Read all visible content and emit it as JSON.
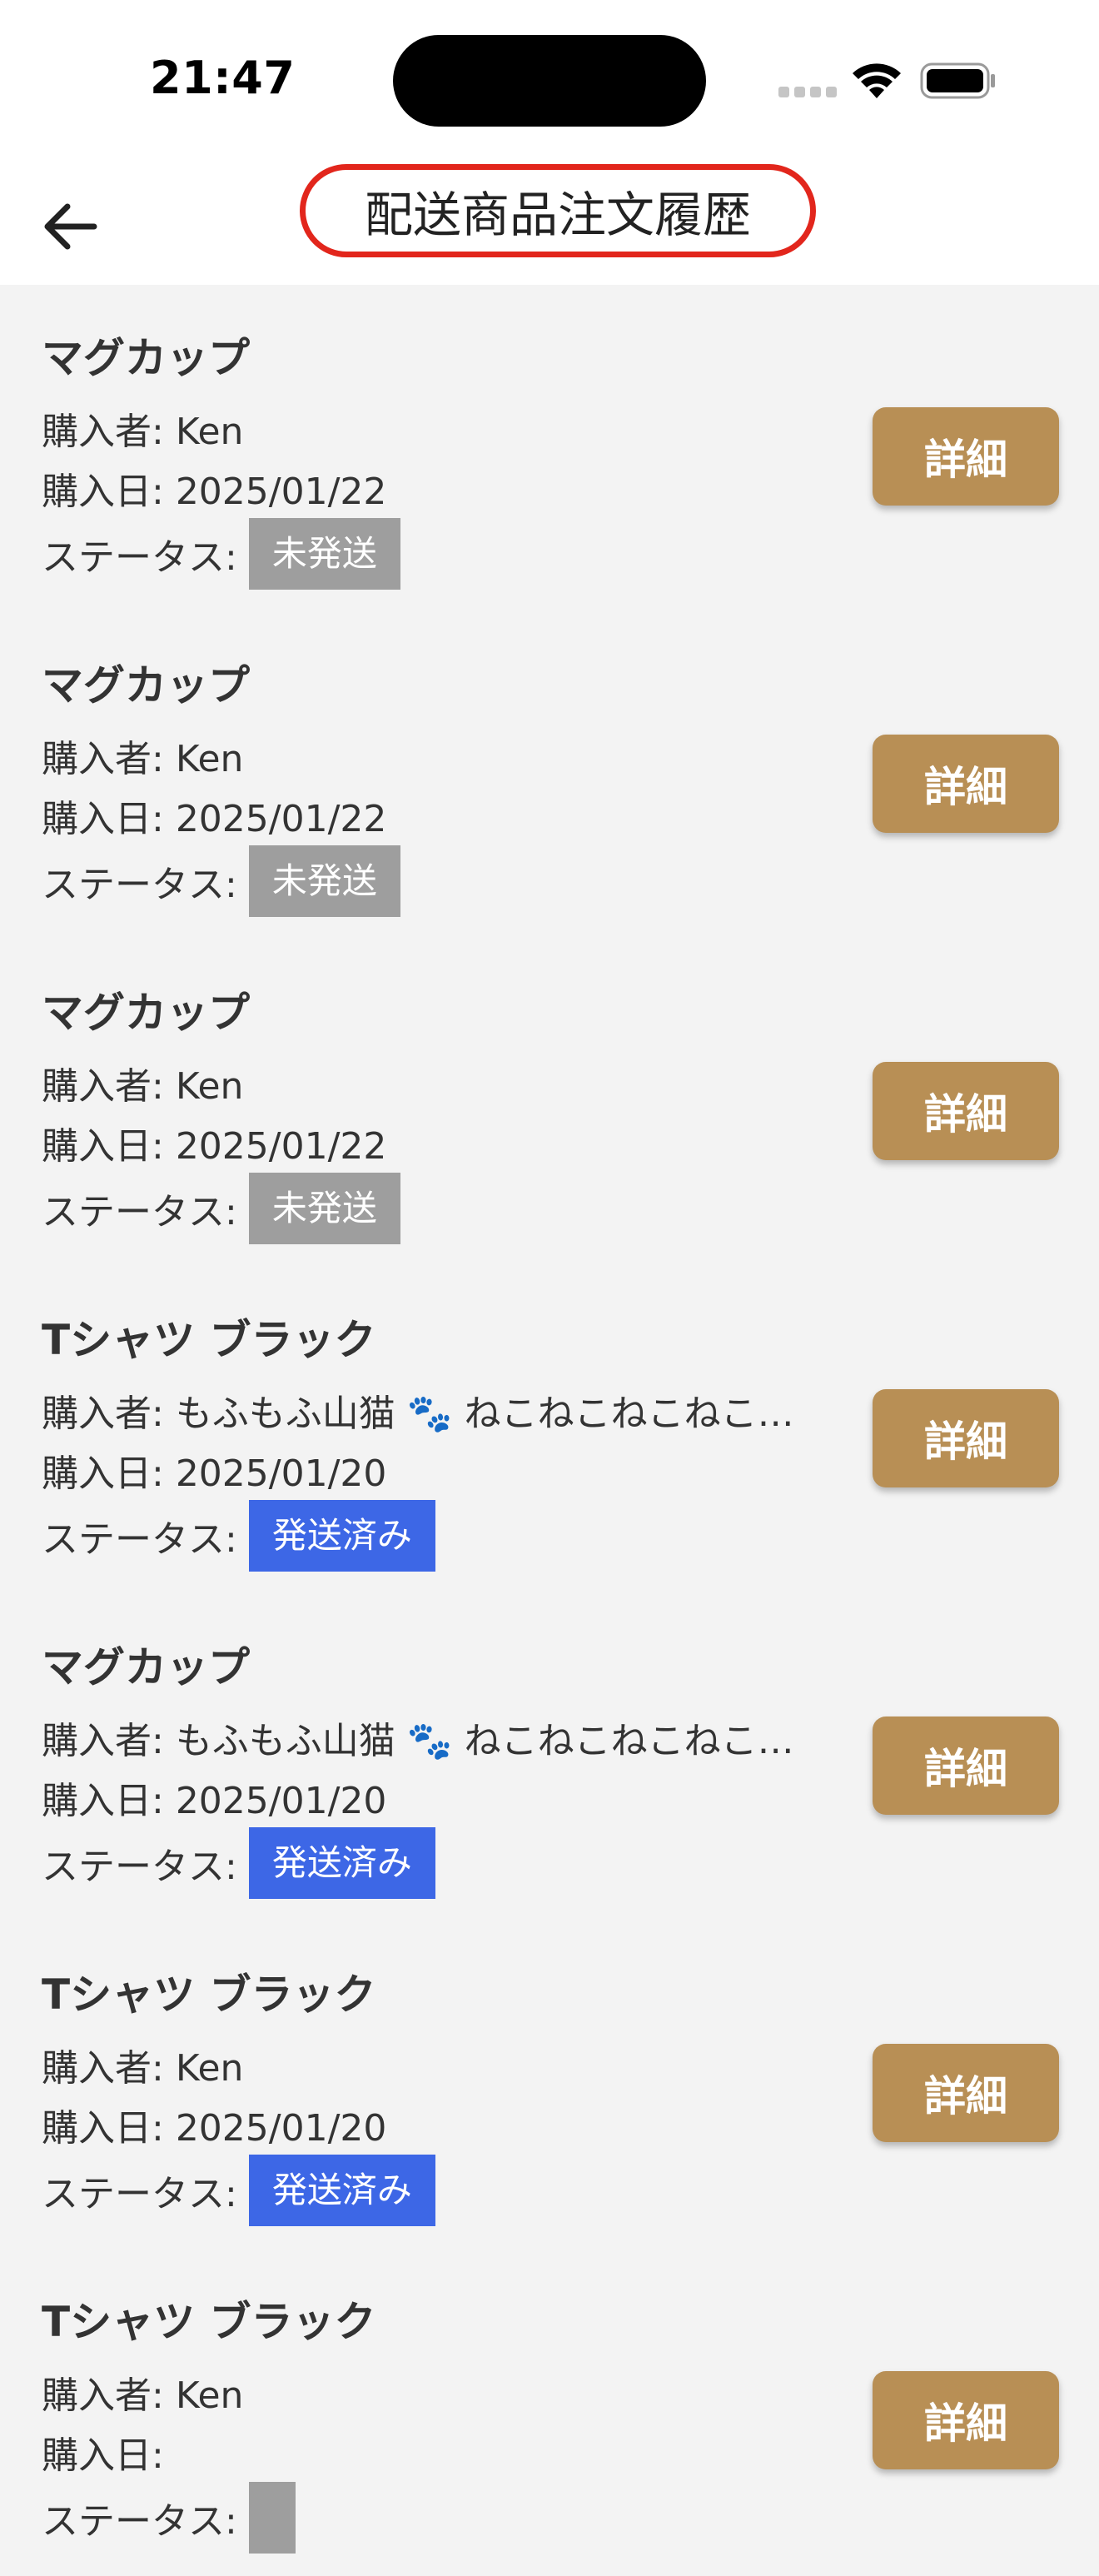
{
  "status_bar": {
    "time": "21:47"
  },
  "nav": {
    "title": "配送商品注文履歴"
  },
  "labels": {
    "buyer": "購入者: ",
    "date": "購入日: ",
    "status": "ステータス:",
    "detail_button": "詳細"
  },
  "colors": {
    "accent_button": "#b88f55",
    "status_pending": "#9e9e9e",
    "status_shipped": "#3d67e6",
    "title_highlight": "#e2261c"
  },
  "orders": [
    {
      "product": "マグカップ",
      "buyer": "Ken",
      "date": "2025/01/22",
      "status": "未発送"
    },
    {
      "product": "マグカップ",
      "buyer": "Ken",
      "date": "2025/01/22",
      "status": "未発送"
    },
    {
      "product": "マグカップ",
      "buyer": "Ken",
      "date": "2025/01/22",
      "status": "未発送"
    },
    {
      "product": "Tシャツ ブラック",
      "buyer": "もふもふ山猫 🐾 ねこねこねこねこ…",
      "date": "2025/01/20",
      "status": "発送済み"
    },
    {
      "product": "マグカップ",
      "buyer": "もふもふ山猫 🐾 ねこねこねこねこ…",
      "date": "2025/01/20",
      "status": "発送済み"
    },
    {
      "product": "Tシャツ ブラック",
      "buyer": "Ken",
      "date": "2025/01/20",
      "status": "発送済み"
    },
    {
      "product": "Tシャツ ブラック",
      "buyer": "Ken",
      "date": "",
      "status": ""
    }
  ]
}
